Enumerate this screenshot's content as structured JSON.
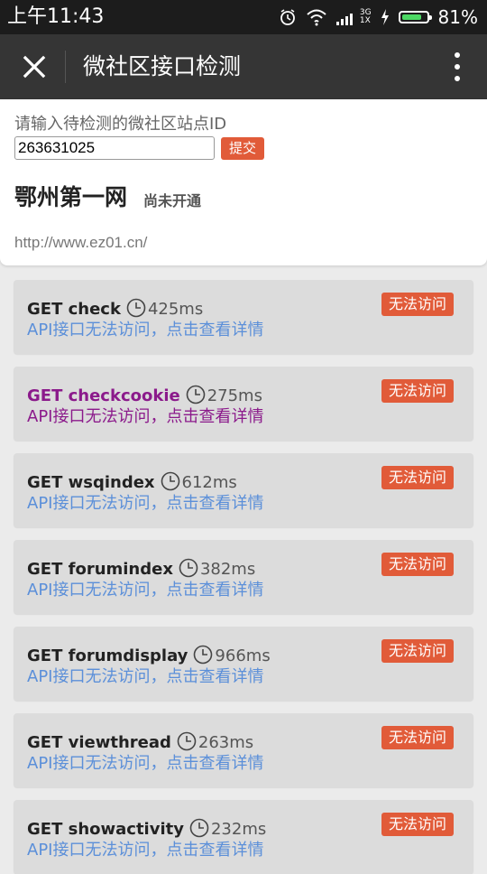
{
  "status_bar": {
    "time": "上午11:43",
    "battery_percent": "81%",
    "battery_level": 0.81,
    "network_top": "3G",
    "network_bottom": "1X",
    "icons": [
      "alarm-icon",
      "wifi-icon",
      "signal-icon",
      "charging-icon",
      "battery-icon"
    ]
  },
  "app_bar": {
    "title": "微社区接口检测",
    "close_icon": "close-icon",
    "menu_icon": "more-vertical-icon"
  },
  "form": {
    "prompt": "请输入待检测的微社区站点ID",
    "site_id": "263631025",
    "submit_label": "提交"
  },
  "site": {
    "name": "鄂州第一网",
    "status": "尚未开通",
    "url": "http://www.ez01.cn/"
  },
  "colors": {
    "accent": "#e15b39",
    "link": "#5b8fd9",
    "visited": "#8b1a8b",
    "app_bar": "#353535"
  },
  "apis": [
    {
      "method": "GET check",
      "time": "425ms",
      "desc": "API接口无法访问，点击查看详情",
      "badge": "无法访问",
      "visited": false
    },
    {
      "method": "GET checkcookie",
      "time": "275ms",
      "desc": "API接口无法访问，点击查看详情",
      "badge": "无法访问",
      "visited": true
    },
    {
      "method": "GET wsqindex",
      "time": "612ms",
      "desc": "API接口无法访问，点击查看详情",
      "badge": "无法访问",
      "visited": false
    },
    {
      "method": "GET forumindex",
      "time": "382ms",
      "desc": "API接口无法访问，点击查看详情",
      "badge": "无法访问",
      "visited": false
    },
    {
      "method": "GET forumdisplay",
      "time": "966ms",
      "desc": "API接口无法访问，点击查看详情",
      "badge": "无法访问",
      "visited": false
    },
    {
      "method": "GET viewthread",
      "time": "263ms",
      "desc": "API接口无法访问，点击查看详情",
      "badge": "无法访问",
      "visited": false
    },
    {
      "method": "GET showactivity",
      "time": "232ms",
      "desc": "API接口无法访问，点击查看详情",
      "badge": "无法访问",
      "visited": false
    }
  ]
}
